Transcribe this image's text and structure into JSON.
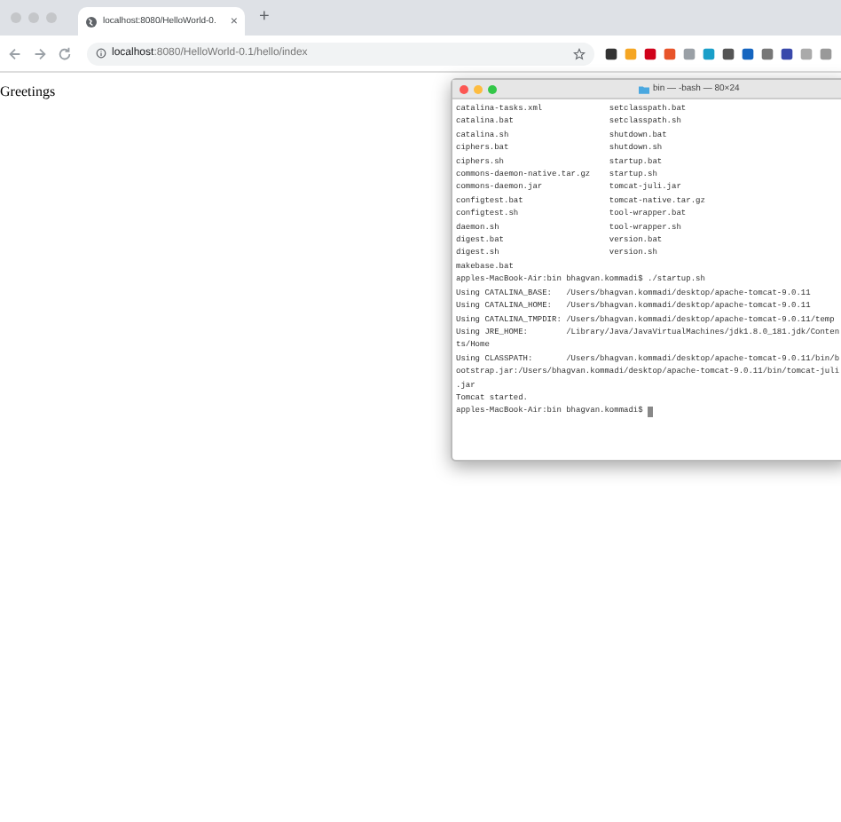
{
  "browser": {
    "tab": {
      "title": "localhost:8080/HelloWorld-0.",
      "close": "×"
    },
    "new_tab": "+",
    "address": {
      "host": "localhost",
      "path": ":8080/HelloWorld-0.1/hello/index"
    }
  },
  "page": {
    "text": "Greetings"
  },
  "terminal": {
    "title": "bin — -bash — 80×24",
    "listing": [
      {
        "left": "catalina-tasks.xml",
        "right": "setclasspath.bat"
      },
      {
        "left": "catalina.bat",
        "right": "setclasspath.sh"
      },
      {
        "left": "catalina.sh",
        "right": "shutdown.bat"
      },
      {
        "left": "ciphers.bat",
        "right": "shutdown.sh"
      },
      {
        "left": "ciphers.sh",
        "right": "startup.bat"
      },
      {
        "left": "commons-daemon-native.tar.gz",
        "right": "startup.sh"
      },
      {
        "left": "commons-daemon.jar",
        "right": "tomcat-juli.jar"
      },
      {
        "left": "configtest.bat",
        "right": "tomcat-native.tar.gz"
      },
      {
        "left": "configtest.sh",
        "right": "tool-wrapper.bat"
      },
      {
        "left": "daemon.sh",
        "right": "tool-wrapper.sh"
      },
      {
        "left": "digest.bat",
        "right": "version.bat"
      },
      {
        "left": "digest.sh",
        "right": "version.sh"
      }
    ],
    "lines": [
      "makebase.bat",
      "apples-MacBook-Air:bin bhagvan.kommadi$ ./startup.sh",
      "Using CATALINA_BASE:   /Users/bhagvan.kommadi/desktop/apache-tomcat-9.0.11",
      "Using CATALINA_HOME:   /Users/bhagvan.kommadi/desktop/apache-tomcat-9.0.11",
      "Using CATALINA_TMPDIR: /Users/bhagvan.kommadi/desktop/apache-tomcat-9.0.11/temp",
      "Using JRE_HOME:        /Library/Java/JavaVirtualMachines/jdk1.8.0_181.jdk/Conten",
      "ts/Home",
      "Using CLASSPATH:       /Users/bhagvan.kommadi/desktop/apache-tomcat-9.0.11/bin/b",
      "ootstrap.jar:/Users/bhagvan.kommadi/desktop/apache-tomcat-9.0.11/bin/tomcat-juli",
      ".jar",
      "Tomcat started."
    ],
    "prompt": "apples-MacBook-Air:bin bhagvan.kommadi$"
  }
}
